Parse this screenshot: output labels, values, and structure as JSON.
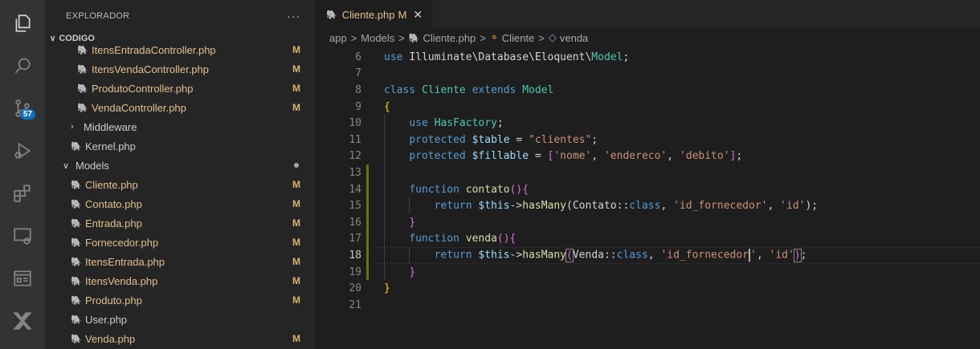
{
  "activity_bar": {
    "scm_badge": "57"
  },
  "sidebar": {
    "title": "EXPLORADOR",
    "more": "···",
    "section": "CODIGO",
    "items": [
      {
        "label": "ItensEntradaController.php",
        "status": "M",
        "kind": "file",
        "indent": 2
      },
      {
        "label": "ItensVendaController.php",
        "status": "M",
        "kind": "file",
        "indent": 2
      },
      {
        "label": "ProdutoController.php",
        "status": "M",
        "kind": "file",
        "indent": 2
      },
      {
        "label": "VendaController.php",
        "status": "M",
        "kind": "file",
        "indent": 2
      },
      {
        "label": "Middleware",
        "status": "",
        "kind": "folder-closed",
        "indent": 1
      },
      {
        "label": "Kernel.php",
        "status": "",
        "kind": "file",
        "indent": 1
      },
      {
        "label": "Models",
        "status": "dot",
        "kind": "folder-open",
        "indent": 0
      },
      {
        "label": "Cliente.php",
        "status": "M",
        "kind": "file",
        "indent": 1
      },
      {
        "label": "Contato.php",
        "status": "M",
        "kind": "file",
        "indent": 1
      },
      {
        "label": "Entrada.php",
        "status": "M",
        "kind": "file",
        "indent": 1
      },
      {
        "label": "Fornecedor.php",
        "status": "M",
        "kind": "file",
        "indent": 1
      },
      {
        "label": "ItensEntrada.php",
        "status": "M",
        "kind": "file",
        "indent": 1
      },
      {
        "label": "ItensVenda.php",
        "status": "M",
        "kind": "file",
        "indent": 1
      },
      {
        "label": "Produto.php",
        "status": "M",
        "kind": "file",
        "indent": 1
      },
      {
        "label": "User.php",
        "status": "",
        "kind": "file",
        "indent": 1
      },
      {
        "label": "Venda.php",
        "status": "M",
        "kind": "file",
        "indent": 1
      }
    ]
  },
  "tab": {
    "label": "Cliente.php",
    "modified": "M",
    "close": "✕"
  },
  "breadcrumb": {
    "folder1": "app",
    "folder2": "Models",
    "file": "Cliente.php",
    "class": "Cliente",
    "method": "venda"
  },
  "code": {
    "current_line": 18,
    "lines": [
      {
        "n": "6",
        "tokens": [
          [
            "kw",
            "use "
          ],
          [
            "plain",
            "Illuminate\\Database\\Eloquent\\"
          ],
          [
            "cls",
            "Model"
          ],
          [
            "plain",
            ";"
          ]
        ]
      },
      {
        "n": "7",
        "tokens": []
      },
      {
        "n": "8",
        "tokens": [
          [
            "kw",
            "class "
          ],
          [
            "cls",
            "Cliente "
          ],
          [
            "kw",
            "extends "
          ],
          [
            "cls",
            "Model"
          ]
        ]
      },
      {
        "n": "9",
        "tokens": [
          [
            "br1",
            "{"
          ]
        ]
      },
      {
        "n": "10",
        "tokens": [
          [
            "plain",
            "    "
          ],
          [
            "kw",
            "use "
          ],
          [
            "cls",
            "HasFactory"
          ],
          [
            "plain",
            ";"
          ]
        ]
      },
      {
        "n": "11",
        "tokens": [
          [
            "plain",
            "    "
          ],
          [
            "kw",
            "protected "
          ],
          [
            "var",
            "$table"
          ],
          [
            "plain",
            " = "
          ],
          [
            "str",
            "\"clientes\""
          ],
          [
            "plain",
            ";"
          ]
        ]
      },
      {
        "n": "12",
        "tokens": [
          [
            "plain",
            "    "
          ],
          [
            "kw",
            "protected "
          ],
          [
            "var",
            "$fillable"
          ],
          [
            "plain",
            " = "
          ],
          [
            "br2",
            "["
          ],
          [
            "str",
            "'nome'"
          ],
          [
            "plain",
            ", "
          ],
          [
            "str",
            "'endereco'"
          ],
          [
            "plain",
            ", "
          ],
          [
            "str",
            "'debito'"
          ],
          [
            "br2",
            "]"
          ],
          [
            "plain",
            ";"
          ]
        ]
      },
      {
        "n": "13",
        "tokens": []
      },
      {
        "n": "14",
        "tokens": [
          [
            "plain",
            "    "
          ],
          [
            "kw",
            "function "
          ],
          [
            "fn",
            "contato"
          ],
          [
            "br2",
            "(){"
          ]
        ]
      },
      {
        "n": "15",
        "tokens": [
          [
            "plain",
            "        "
          ],
          [
            "kw",
            "return "
          ],
          [
            "var",
            "$this"
          ],
          [
            "plain",
            "->"
          ],
          [
            "fn",
            "hasMany"
          ],
          [
            "plain",
            "(Contato::"
          ],
          [
            "kw",
            "class"
          ],
          [
            "plain",
            ", "
          ],
          [
            "str",
            "'id_fornecedor'"
          ],
          [
            "plain",
            ", "
          ],
          [
            "str",
            "'id'"
          ],
          [
            "plain",
            ");"
          ]
        ]
      },
      {
        "n": "16",
        "tokens": [
          [
            "plain",
            "    "
          ],
          [
            "br2",
            "}"
          ]
        ]
      },
      {
        "n": "17",
        "tokens": [
          [
            "plain",
            "    "
          ],
          [
            "kw",
            "function "
          ],
          [
            "fn",
            "venda"
          ],
          [
            "br2",
            "(){"
          ]
        ]
      },
      {
        "n": "18",
        "tokens": [
          [
            "plain",
            "        "
          ],
          [
            "kw",
            "return "
          ],
          [
            "var",
            "$this"
          ],
          [
            "plain",
            "->"
          ],
          [
            "fn",
            "hasMany"
          ],
          [
            "box",
            "("
          ],
          [
            "plain",
            "Venda::"
          ],
          [
            "kw",
            "class"
          ],
          [
            "plain",
            ", "
          ],
          [
            "str",
            "'id_fornecedor"
          ],
          [
            "cursor",
            ""
          ],
          [
            "str",
            "'"
          ],
          [
            "plain",
            ", "
          ],
          [
            "str",
            "'id'"
          ],
          [
            "box",
            ")"
          ],
          [
            "plain",
            ";"
          ]
        ]
      },
      {
        "n": "19",
        "tokens": [
          [
            "plain",
            "    "
          ],
          [
            "br2",
            "}"
          ]
        ]
      },
      {
        "n": "20",
        "tokens": [
          [
            "br1",
            "}"
          ]
        ]
      },
      {
        "n": "21",
        "tokens": []
      }
    ]
  }
}
